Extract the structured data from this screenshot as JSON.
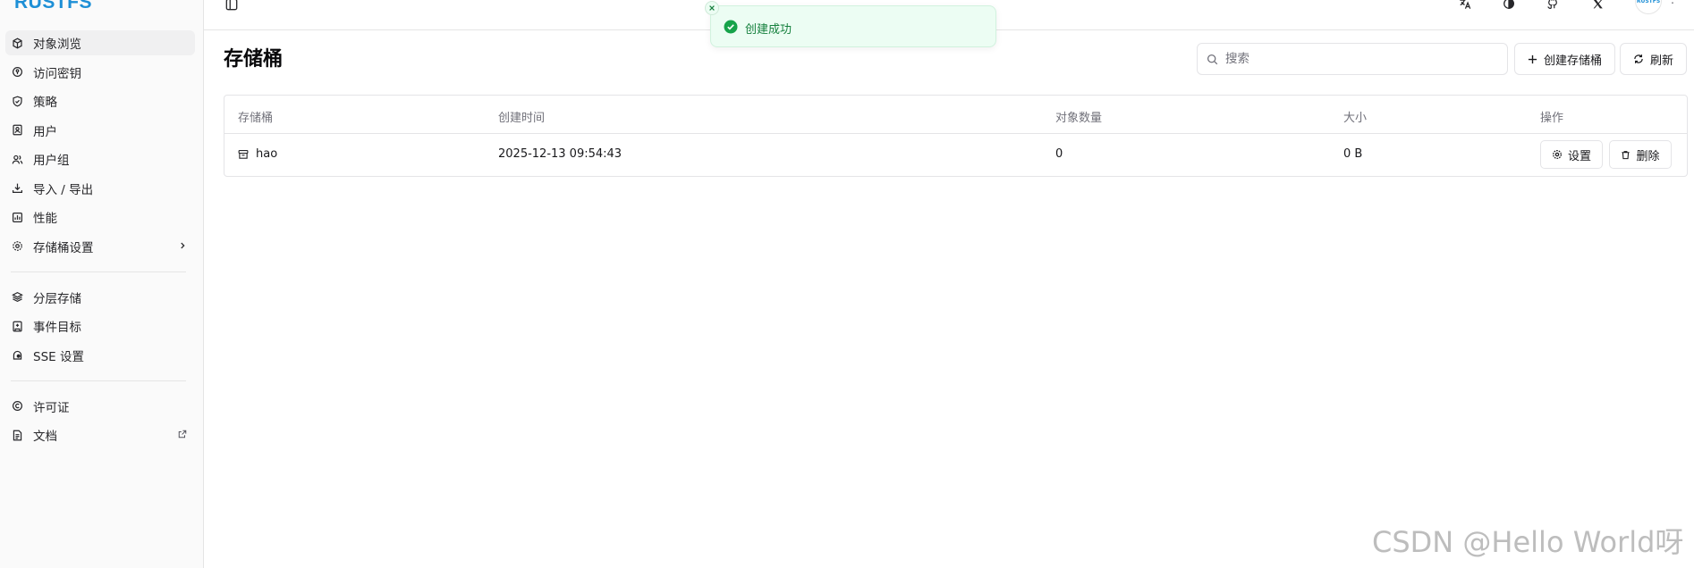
{
  "app": {
    "logo_text": "RUSTFS",
    "avatar_text": "RUSTFS"
  },
  "sidebar": {
    "group1": [
      {
        "label": "对象浏览",
        "icon": "cube-icon",
        "active": true
      },
      {
        "label": "访问密钥",
        "icon": "key-icon"
      },
      {
        "label": "策略",
        "icon": "shield-icon"
      },
      {
        "label": "用户",
        "icon": "user-icon"
      },
      {
        "label": "用户组",
        "icon": "users-icon"
      },
      {
        "label": "导入 / 导出",
        "icon": "download-icon"
      },
      {
        "label": "性能",
        "icon": "chart-icon"
      },
      {
        "label": "存储桶设置",
        "icon": "gear-icon",
        "trailing": "chevron-right-icon"
      }
    ],
    "group2": [
      {
        "label": "分层存储",
        "icon": "layers-icon"
      },
      {
        "label": "事件目标",
        "icon": "target-icon"
      },
      {
        "label": "SSE 设置",
        "icon": "lock-icon"
      }
    ],
    "group3": [
      {
        "label": "许可证",
        "icon": "copyright-icon"
      },
      {
        "label": "文档",
        "icon": "document-icon",
        "trailing": "external-link-icon"
      }
    ]
  },
  "topbar": {
    "icons": [
      "translate-icon",
      "theme-icon",
      "github-icon",
      "x-icon"
    ]
  },
  "toast": {
    "message": "创建成功",
    "type": "success",
    "color": "#15803d"
  },
  "main": {
    "title": "存储桶",
    "search_placeholder": "搜索",
    "create_label": "创建存储桶",
    "refresh_label": "刷新",
    "table": {
      "columns": [
        "存储桶",
        "创建时间",
        "对象数量",
        "大小",
        "操作"
      ],
      "rows": [
        {
          "name": "hao",
          "created": "2025-12-13 09:54:43",
          "objects": "0",
          "size": "0 B",
          "settings_label": "设置",
          "delete_label": "删除"
        }
      ]
    }
  },
  "watermark": "CSDN @Hello World呀",
  "colors": {
    "brand": "#1d8fd6",
    "border": "#e4e4e7",
    "success_bg": "#ecfdf3"
  }
}
